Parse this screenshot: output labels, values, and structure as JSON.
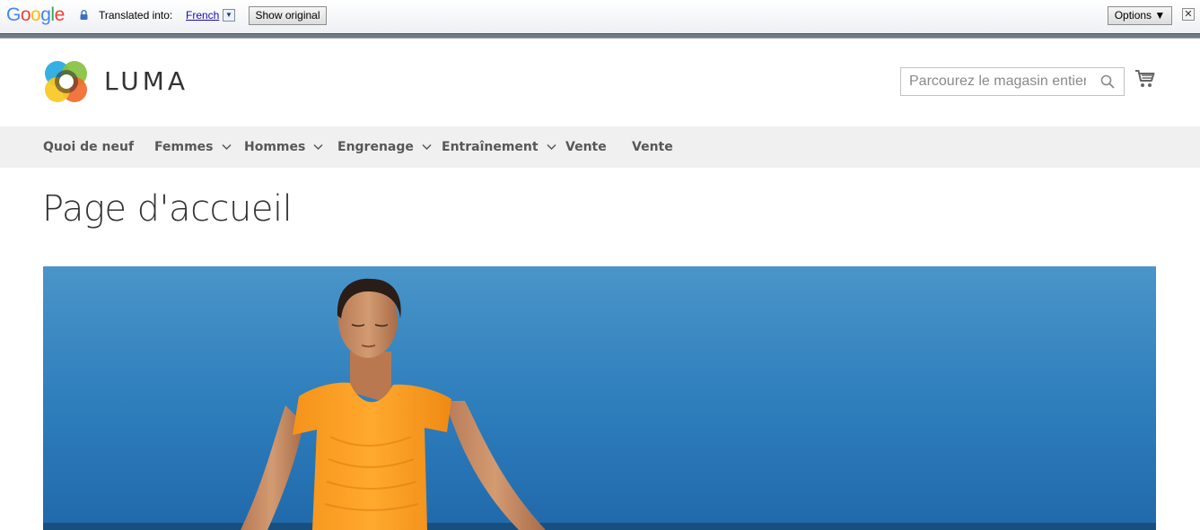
{
  "translate_bar": {
    "translated_into_label": "Translated into:",
    "language": "French",
    "dropdown_glyph": "▼",
    "show_original_label": "Show original",
    "options_label": "Options ▼",
    "close_glyph": "✕"
  },
  "header": {
    "brand": "LUMA",
    "search_placeholder": "Parcourez le magasin entier...",
    "icons": [
      "luma-logo",
      "search-icon",
      "cart-icon"
    ]
  },
  "nav": {
    "items": [
      {
        "label": "Quoi de neuf",
        "has_submenu": false
      },
      {
        "label": "Femmes",
        "has_submenu": true
      },
      {
        "label": "Hommes",
        "has_submenu": true
      },
      {
        "label": "Engrenage",
        "has_submenu": true
      },
      {
        "label": "Entraînement",
        "has_submenu": true
      },
      {
        "label": "Vente",
        "has_submenu": false
      },
      {
        "label": "Vente",
        "has_submenu": false
      }
    ]
  },
  "main": {
    "page_title": "Page d'accueil"
  },
  "colors": {
    "nav_bg": "#f0f0f0",
    "text_dark": "#333333",
    "nav_text": "#575757",
    "hero_sky": "#2c7cbb",
    "shirt_orange": "#ff9a1f"
  }
}
